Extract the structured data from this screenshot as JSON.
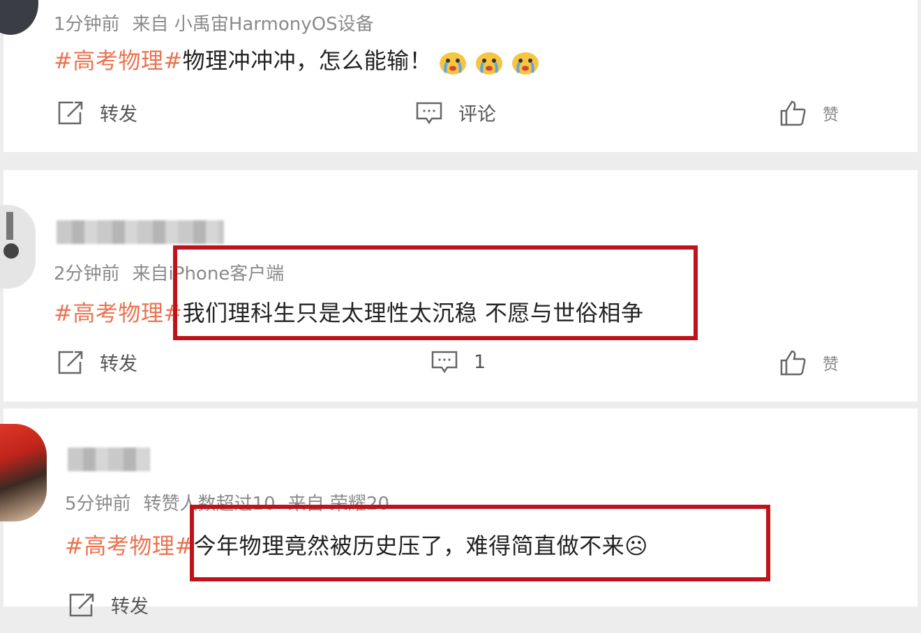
{
  "posts": [
    {
      "time": "1分钟前",
      "source": "来自 小禹宙HarmonyOS设备",
      "hashtag": "#高考物理#",
      "text": "物理冲冲冲，怎么能输！",
      "emoji_icon": "crying-face-emoji",
      "actions": {
        "repost": "转发",
        "comment": "评论",
        "like": "赞"
      }
    },
    {
      "time": "2分钟前",
      "source": "来自iPhone客户端",
      "hashtag": "#高考物理#",
      "text": "我们理科生只是太理性太沉稳 不愿与世俗相争",
      "actions": {
        "repost": "转发",
        "comment": "1",
        "like": "赞"
      }
    },
    {
      "time": "5分钟前",
      "extra": "转赞人数超过10",
      "source": "来自 荣耀20",
      "hashtag": "#高考物理#",
      "text": "今年物理竟然被历史压了，难得简直做不来☹",
      "actions": {
        "repost": "转发"
      }
    }
  ],
  "colors": {
    "hashtag": "#eb7350",
    "highlight_box": "#c1121c",
    "meta": "#8a8a8a"
  }
}
